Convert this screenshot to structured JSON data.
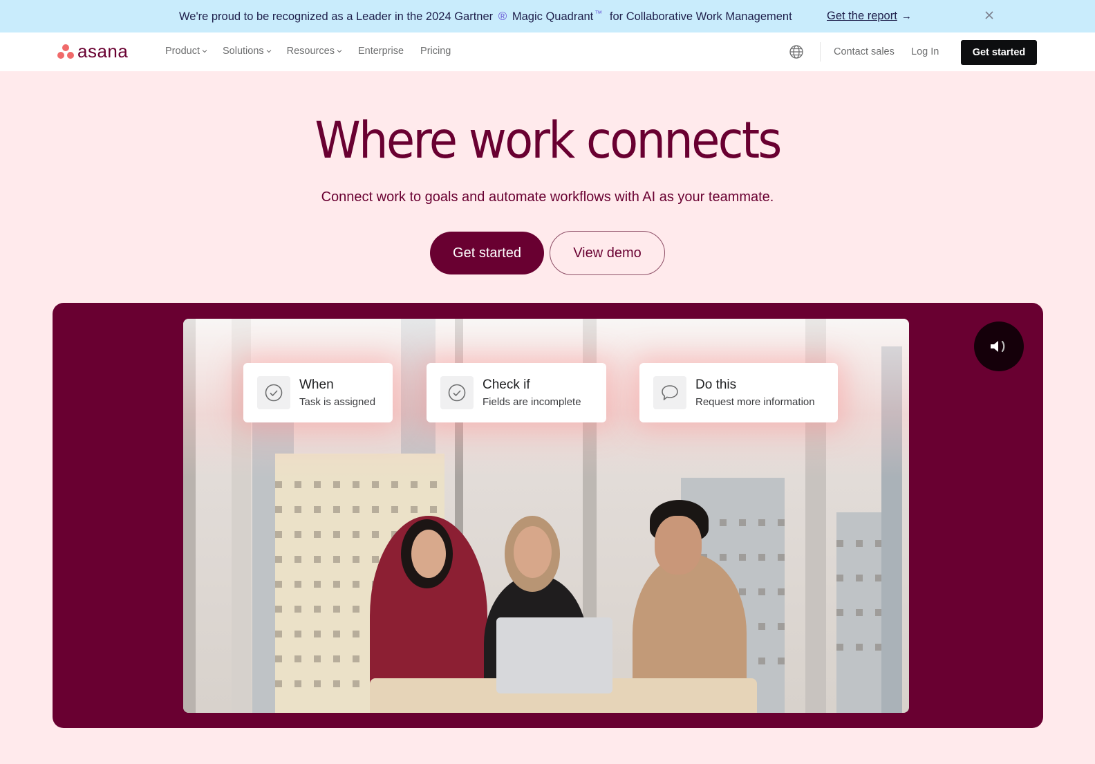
{
  "banner": {
    "text_before": "We're proud to be recognized as a Leader in the 2024 Gartner",
    "registered_mark": "®",
    "text_mid": "Magic Quadrant",
    "trademark": "™",
    "text_after": "for Collaborative Work Management",
    "link_label": "Get the report",
    "link_arrow": "→",
    "close_icon": "close-icon"
  },
  "nav": {
    "logo_text": "asana",
    "logo_color": "#f06a6a",
    "links": [
      {
        "label": "Product",
        "has_dropdown": true
      },
      {
        "label": "Solutions",
        "has_dropdown": true
      },
      {
        "label": "Resources",
        "has_dropdown": true
      },
      {
        "label": "Enterprise",
        "has_dropdown": false
      },
      {
        "label": "Pricing",
        "has_dropdown": false
      }
    ],
    "globe_icon": "globe-icon",
    "contact_sales": "Contact sales",
    "log_in": "Log In",
    "cta": "Get started"
  },
  "hero": {
    "title": "Where work connects",
    "subtitle": "Connect work to goals and automate workflows with AI as your teammate.",
    "primary_button": "Get started",
    "secondary_button": "View demo",
    "brand_color": "#690031"
  },
  "media": {
    "description": "Video of three coworkers around a laptop in an office with city view",
    "sound_icon": "speaker-icon",
    "workflow_cards": [
      {
        "title": "When",
        "subtitle": "Task is assigned",
        "icon": "check-circle-icon"
      },
      {
        "title": "Check if",
        "subtitle": "Fields are incomplete",
        "icon": "check-circle-icon"
      },
      {
        "title": "Do this",
        "subtitle": "Request more information",
        "icon": "comment-icon"
      }
    ]
  }
}
